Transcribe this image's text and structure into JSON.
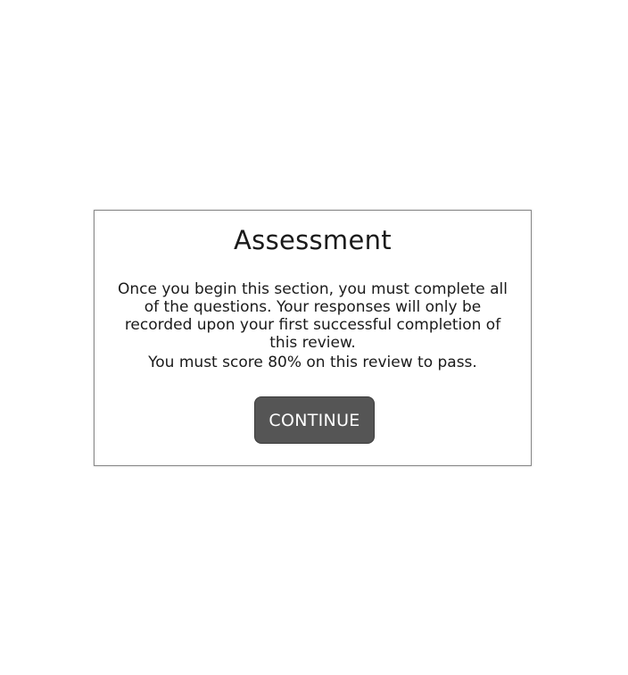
{
  "dialog": {
    "title": "Assessment",
    "body": "Once you begin this section, you must complete all of the questions. Your responses will only be recorded upon your first successful completion of this review.",
    "pass_requirement": "You must score 80% on this review to pass.",
    "continue_label": "CONTINUE"
  },
  "colors": {
    "button_background": "#555555",
    "button_text": "#ffffff",
    "border": "#8a8a8a"
  }
}
